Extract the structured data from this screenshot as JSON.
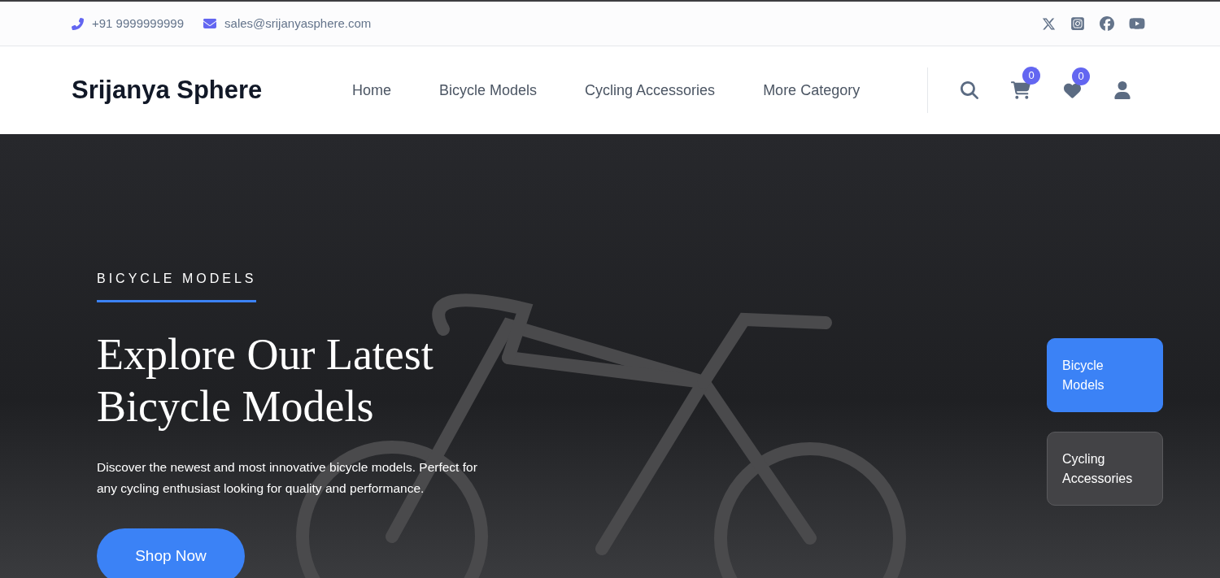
{
  "topbar": {
    "phone": "+91 9999999999",
    "email": "sales@srijanyasphere.com"
  },
  "header": {
    "brand": "Srijanya Sphere",
    "nav": [
      "Home",
      "Bicycle Models",
      "Cycling Accessories",
      "More Category"
    ],
    "cart_count": "0",
    "wishlist_count": "0"
  },
  "hero": {
    "eyebrow": "BICYCLE MODELS",
    "title_lines": [
      "Explore Our Latest",
      "Bicycle Models"
    ],
    "description": "Discover the newest and most innovative bicycle models. Perfect for any cycling enthusiast looking for quality and performance.",
    "button": "Shop Now",
    "slides": [
      {
        "label": "Bicycle Models",
        "selected": true
      },
      {
        "label": "Cycling Accessories",
        "selected": false
      }
    ]
  }
}
